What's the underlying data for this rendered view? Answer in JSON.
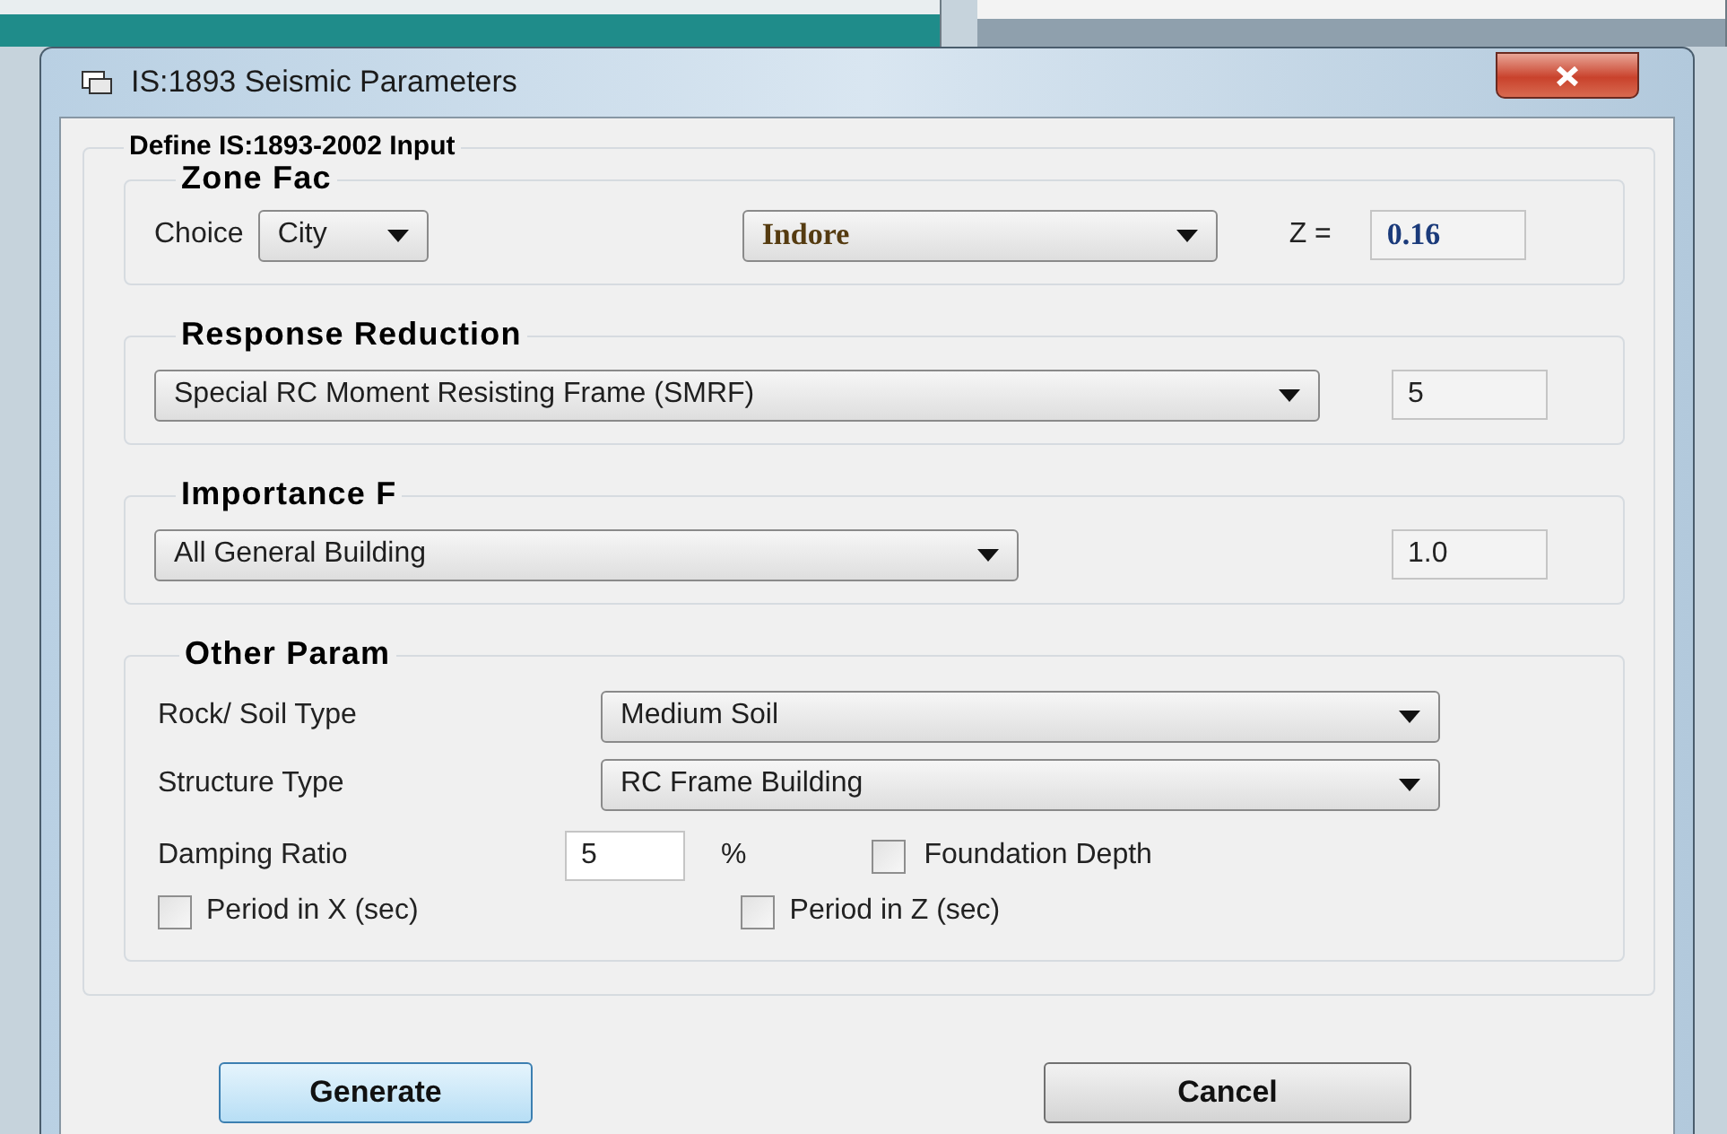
{
  "window": {
    "title": "IS:1893 Seismic Parameters"
  },
  "form": {
    "title": "Define IS:1893-2002 Input"
  },
  "zone_factor": {
    "title": "Zone Fac",
    "choice_label": "Choice",
    "choice": "City",
    "city": "Indore",
    "z_label": "Z =",
    "z_value": "0.16"
  },
  "response_reduction": {
    "title": "Response Reduction",
    "frame_type": "Special RC Moment Resisting Frame (SMRF)",
    "value": "5"
  },
  "importance_factor": {
    "title": "Importance F",
    "building_type": "All General Building",
    "value": "1.0"
  },
  "other_parameters": {
    "title": "Other Param",
    "soil_label": "Rock/ Soil Type",
    "soil": "Medium Soil",
    "structure_label": "Structure Type",
    "structure": "RC Frame Building",
    "damping_label": "Damping Ratio",
    "damping": "5",
    "damping_unit": "%",
    "checkboxes": [
      {
        "label": "Foundation Depth",
        "checked": false
      },
      {
        "label": "Period in X (sec)",
        "checked": false
      },
      {
        "label": "Period in Z (sec)",
        "checked": false
      }
    ]
  },
  "buttons": [
    {
      "label": "Generate",
      "focused": true
    },
    {
      "label": "Cancel",
      "focused": false
    }
  ]
}
